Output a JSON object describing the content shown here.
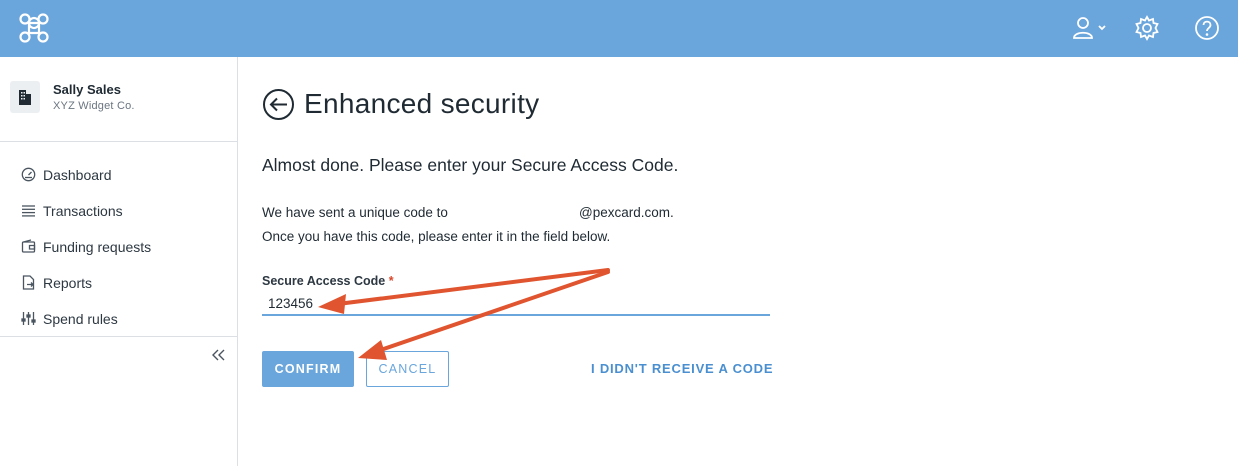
{
  "colors": {
    "topbar": "#6aa6dc",
    "accent": "#6aa6dc",
    "link": "#4a8fd0",
    "annotation_arrow": "#e0552f",
    "required_mark": "#d9472b"
  },
  "header": {
    "icons": [
      "app-logo-icon",
      "user-icon",
      "settings-icon",
      "help-icon"
    ]
  },
  "user": {
    "name": "Sally Sales",
    "company": "XYZ Widget Co."
  },
  "sidebar": {
    "items": [
      {
        "label": "Dashboard",
        "icon": "dashboard-icon"
      },
      {
        "label": "Transactions",
        "icon": "list-icon"
      },
      {
        "label": "Funding requests",
        "icon": "wallet-icon"
      },
      {
        "label": "Reports",
        "icon": "report-icon"
      },
      {
        "label": "Spend rules",
        "icon": "sliders-icon"
      }
    ],
    "collapse_icon": "double-chevron-left-icon"
  },
  "page": {
    "title": "Enhanced security",
    "subtitle": "Almost done. Please enter your Secure Access Code.",
    "info_line1_prefix": "We have sent a unique code to",
    "info_line1_email_suffix": "@pexcard.com.",
    "info_line2": "Once you have this code, please enter it in the field below."
  },
  "form": {
    "code_label": "Secure Access Code",
    "required_mark": "*",
    "code_value": "123456"
  },
  "actions": {
    "confirm": "CONFIRM",
    "cancel": "CANCEL",
    "no_code": "I DIDN'T RECEIVE A CODE"
  }
}
